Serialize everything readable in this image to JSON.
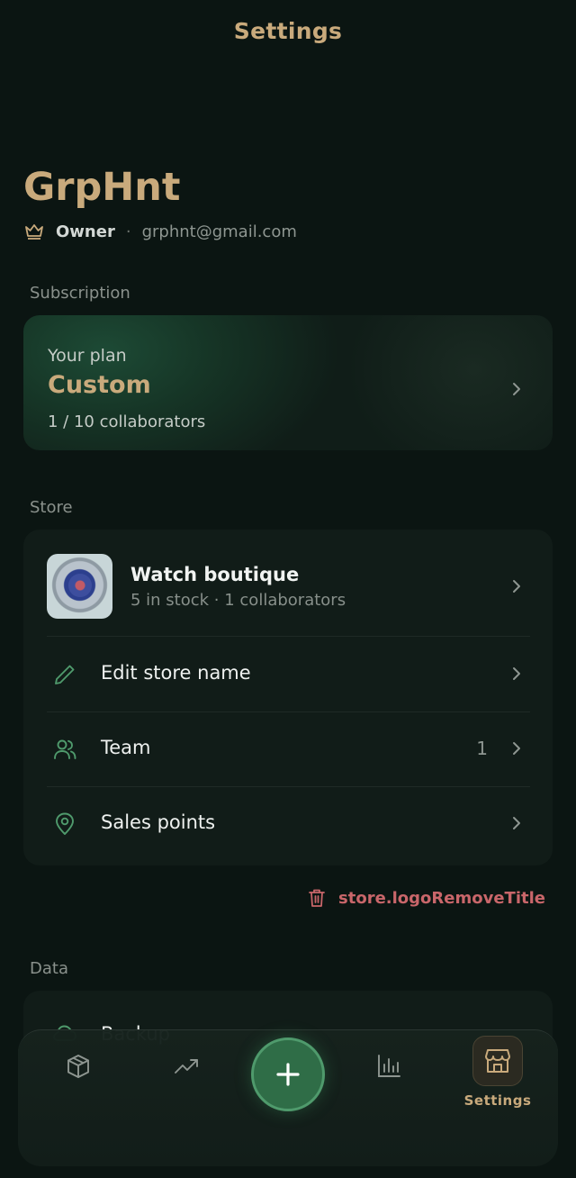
{
  "header": {
    "title": "Settings"
  },
  "profile": {
    "name": "GrpHnt",
    "role": "Owner",
    "separator": "·",
    "email": "grphnt@gmail.com"
  },
  "subscription": {
    "section_label": "Subscription",
    "plan_label": "Your plan",
    "plan_name": "Custom",
    "collaborators": "1 / 10 collaborators"
  },
  "store": {
    "section_label": "Store",
    "name": "Watch boutique",
    "meta": "5 in stock · 1 collaborators",
    "rows": [
      {
        "label": "Edit store name",
        "icon": "pencil-icon"
      },
      {
        "label": "Team",
        "icon": "users-icon",
        "count": "1"
      },
      {
        "label": "Sales points",
        "icon": "map-pin-icon"
      }
    ],
    "remove_logo_label": "store.logoRemoveTitle"
  },
  "data_section": {
    "section_label": "Data",
    "first_row_label": "Backup"
  },
  "tabbar": {
    "items": [
      {
        "icon": "box-icon"
      },
      {
        "icon": "trending-up-icon"
      },
      {
        "icon": "plus-icon"
      },
      {
        "icon": "bar-chart-icon"
      },
      {
        "icon": "store-icon",
        "label": "Settings",
        "active": true
      }
    ]
  },
  "colors": {
    "background": "#0b1512",
    "gold_accent": "#c9aa7c",
    "green_icon": "#4f9a6c",
    "danger": "#c9666a",
    "card": "#111c18"
  }
}
